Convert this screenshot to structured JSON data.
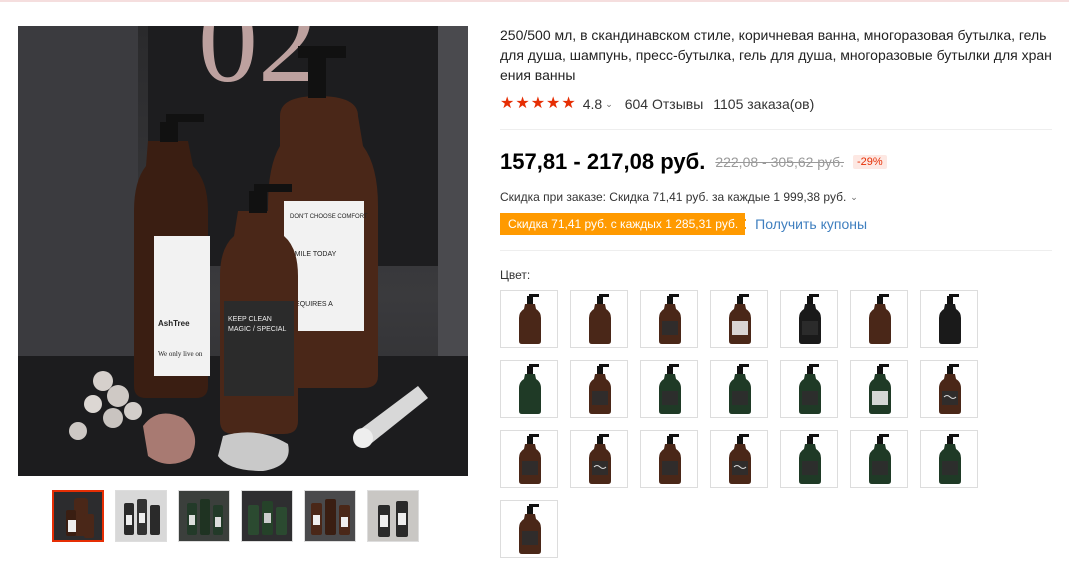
{
  "product": {
    "title": "250/500 мл, в скандинавском стиле, коричневая ванна, многоразовая бутылка, гель для душа, шампунь, пресс-бутылка, гель для душа, многоразовые бутылки для хранения ванны",
    "rating": "4.8",
    "reviews": "604 Отзывы",
    "orders": "1105 заказа(ов)",
    "price": "157,81 - 217,08 руб.",
    "old_price": "222,08 - 305,62 руб.",
    "discount": "-29%",
    "order_discount": "Скидка при заказе: Скидка 71,41 руб. за каждые 1 999,38 руб.",
    "coupon_tag": "Скидка 71,41 руб. с каждых 1 285,31 руб.",
    "get_coupons": "Получить купоны",
    "color_label": "Цвет:"
  },
  "colors": {
    "accent_red": "#e62e04",
    "coupon_orange": "#ff9a00",
    "link_blue": "#3f7fbf"
  },
  "gallery": {
    "main_image": "shampoo-bottles-photo",
    "thumbnail_count": 6,
    "active_thumbnail": 1
  },
  "swatches": [
    {
      "variant": "brown-black-pump"
    },
    {
      "variant": "brown-black-pump"
    },
    {
      "variant": "brown-label-pump"
    },
    {
      "variant": "brown-white-label"
    },
    {
      "variant": "black-pump-label"
    },
    {
      "variant": "brown-black-pump"
    },
    {
      "variant": "black-black-pump"
    },
    {
      "variant": "green-black-pump"
    },
    {
      "variant": "brown-label-pump"
    },
    {
      "variant": "green-label-pump"
    },
    {
      "variant": "green-label-pump"
    },
    {
      "variant": "green-label-pump"
    },
    {
      "variant": "green-white-label"
    },
    {
      "variant": "brown-script-label"
    },
    {
      "variant": "brown-label-pump"
    },
    {
      "variant": "brown-script-label"
    },
    {
      "variant": "brown-label-pump"
    },
    {
      "variant": "brown-script-label"
    },
    {
      "variant": "green-label-pump"
    },
    {
      "variant": "green-label-pump"
    },
    {
      "variant": "green-label-pump"
    },
    {
      "variant": "brown-label-pump"
    }
  ]
}
